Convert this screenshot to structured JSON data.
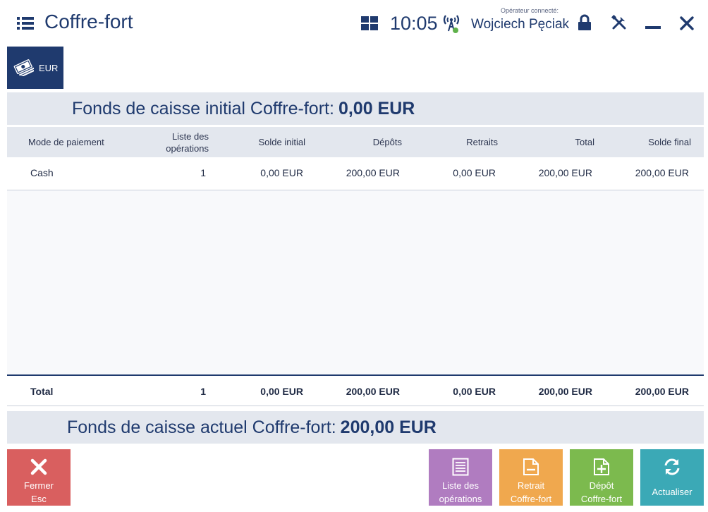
{
  "header": {
    "title": "Coffre-fort",
    "clock": "10:05",
    "operator_label": "Opérateur connecté:",
    "operator_name": "Wojciech Pęciak"
  },
  "currency_tab": {
    "label": "EUR"
  },
  "initial_fund": {
    "label": "Fonds de caisse initial Coffre-fort:",
    "amount": "0,00 EUR"
  },
  "current_fund": {
    "label": "Fonds de caisse actuel Coffre-fort:",
    "amount": "200,00 EUR"
  },
  "table": {
    "columns": {
      "mode": "Mode de paiement",
      "ops_line1": "Liste des",
      "ops_line2": "opérations",
      "initial": "Solde initial",
      "deposits": "Dépôts",
      "withdrawals": "Retraits",
      "total": "Total",
      "final": "Solde final"
    },
    "rows": [
      {
        "mode": "Cash",
        "ops": "1",
        "initial": "0,00 EUR",
        "deposits": "200,00 EUR",
        "withdrawals": "0,00 EUR",
        "total": "200,00 EUR",
        "final": "200,00 EUR"
      }
    ],
    "totals": {
      "label": "Total",
      "ops": "1",
      "initial": "0,00 EUR",
      "deposits": "200,00 EUR",
      "withdrawals": "0,00 EUR",
      "total": "200,00 EUR",
      "final": "200,00 EUR"
    }
  },
  "buttons": {
    "close_line1": "Fermer",
    "close_line2": "Esc",
    "ops_line1": "Liste des",
    "ops_line2": "opérations",
    "withdraw_line1": "Retrait",
    "withdraw_line2": "Coffre-fort",
    "deposit_line1": "Dépôt",
    "deposit_line2": "Coffre-fort",
    "refresh": "Actualiser"
  },
  "colors": {
    "primary": "#1f3a6e",
    "close": "#d95f5f",
    "operations": "#b07cc0",
    "withdraw": "#f0a84e",
    "deposit": "#7cba4e",
    "refresh": "#3ba9b6",
    "online": "#5fb14a"
  }
}
